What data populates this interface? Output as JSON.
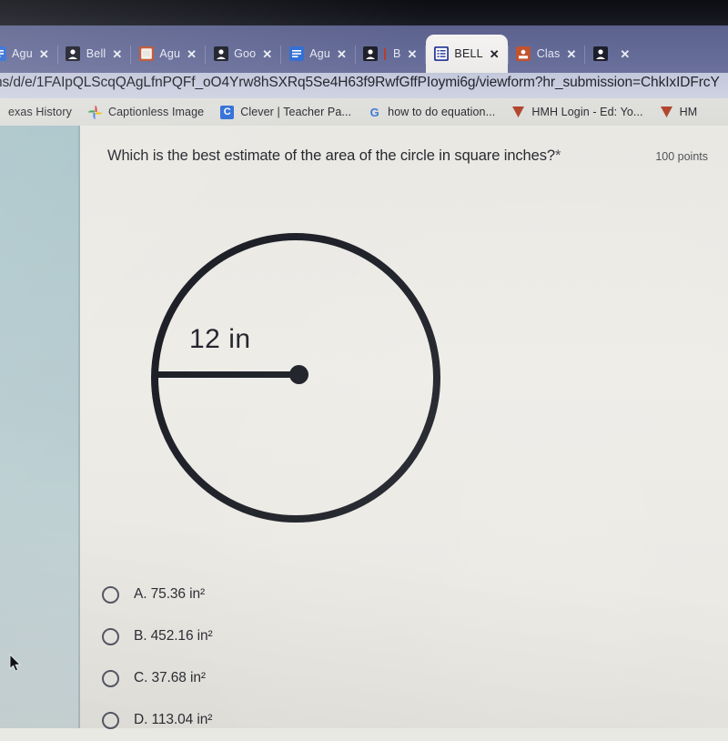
{
  "browser": {
    "tabs": [
      {
        "title": "Agu",
        "favicon": "google-docs-icon",
        "active": false,
        "has_red_bar": false
      },
      {
        "title": "Bell",
        "favicon": "google-contacts-icon",
        "active": false,
        "has_red_bar": false
      },
      {
        "title": "Agu",
        "favicon": "google-slides-icon",
        "active": false,
        "has_red_bar": false
      },
      {
        "title": "Goo",
        "favicon": "google-contacts-icon",
        "active": false,
        "has_red_bar": false
      },
      {
        "title": "Agu",
        "favicon": "google-docs-icon",
        "active": false,
        "has_red_bar": false
      },
      {
        "title": "B",
        "favicon": "google-contacts-icon",
        "active": false,
        "has_red_bar": true
      },
      {
        "title": "BELL",
        "favicon": "google-forms-icon",
        "active": true,
        "has_red_bar": false
      },
      {
        "title": "Clas",
        "favicon": "google-classroom-icon",
        "active": false,
        "has_red_bar": false
      },
      {
        "title": "",
        "favicon": "google-contacts-icon",
        "active": false,
        "has_red_bar": false
      }
    ],
    "tab_close_label": "✕",
    "url": "ns/d/e/1FAIpQLScqQAgLfnPQFf_oO4Yrw8hSXRq5Se4H63f9RwfGffPIoymi6g/viewform?hr_submission=ChkIxIDFrcY",
    "bookmarks": [
      {
        "label": "exas History",
        "icon": "none"
      },
      {
        "label": "Captionless Image",
        "icon": "google-photos-icon"
      },
      {
        "label": "Clever | Teacher Pa...",
        "icon": "clever-icon"
      },
      {
        "label": "how to do equation...",
        "icon": "google-search-icon"
      },
      {
        "label": "HMH Login - Ed: Yo...",
        "icon": "hmh-icon"
      },
      {
        "label": "HM",
        "icon": "hmh-icon"
      }
    ]
  },
  "form": {
    "question": "Which is the best estimate of the area of the circle in square inches?",
    "required_marker": "*",
    "points": "100 points",
    "figure": {
      "shape": "circle",
      "radius_label": "12 in"
    },
    "options": [
      {
        "label": "A. 75.36 in²",
        "selected": false
      },
      {
        "label": "B. 452.16 in²",
        "selected": false
      },
      {
        "label": "C. 37.68 in²",
        "selected": false
      },
      {
        "label": "D. 113.04 in²",
        "selected": false
      }
    ]
  },
  "colors": {
    "tabstrip": "#626a99",
    "active_tab": "#f0eeec",
    "page_rail": "#b6ccd1",
    "card": "#ece9e4",
    "ink": "#1d1f28"
  }
}
